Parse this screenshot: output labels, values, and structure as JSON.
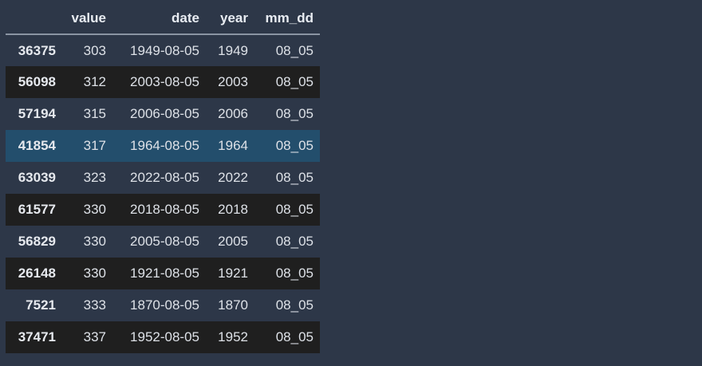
{
  "table": {
    "index_header": "",
    "columns": [
      "value",
      "date",
      "year",
      "mm_dd"
    ],
    "rows": [
      {
        "index": "36375",
        "value": "303",
        "date": "1949-08-05",
        "year": "1949",
        "mm_dd": "08_05"
      },
      {
        "index": "56098",
        "value": "312",
        "date": "2003-08-05",
        "year": "2003",
        "mm_dd": "08_05"
      },
      {
        "index": "57194",
        "value": "315",
        "date": "2006-08-05",
        "year": "2006",
        "mm_dd": "08_05"
      },
      {
        "index": "41854",
        "value": "317",
        "date": "1964-08-05",
        "year": "1964",
        "mm_dd": "08_05"
      },
      {
        "index": "63039",
        "value": "323",
        "date": "2022-08-05",
        "year": "2022",
        "mm_dd": "08_05"
      },
      {
        "index": "61577",
        "value": "330",
        "date": "2018-08-05",
        "year": "2018",
        "mm_dd": "08_05"
      },
      {
        "index": "56829",
        "value": "330",
        "date": "2005-08-05",
        "year": "2005",
        "mm_dd": "08_05"
      },
      {
        "index": "26148",
        "value": "330",
        "date": "1921-08-05",
        "year": "1921",
        "mm_dd": "08_05"
      },
      {
        "index": "7521",
        "value": "333",
        "date": "1870-08-05",
        "year": "1870",
        "mm_dd": "08_05"
      },
      {
        "index": "37471",
        "value": "337",
        "date": "1952-08-05",
        "year": "1952",
        "mm_dd": "08_05"
      }
    ]
  },
  "colors": {
    "background": "#2d3748",
    "row_alt": "#1f1f1f",
    "row_hover": "#234e6c",
    "header_rule": "#8a94a3"
  }
}
